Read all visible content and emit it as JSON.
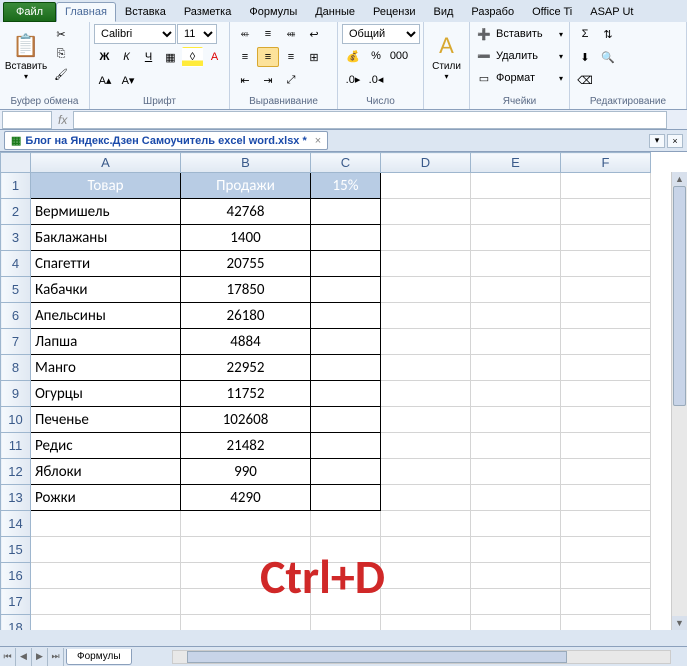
{
  "titlebar": {
    "help": "?",
    "minimize": "▭",
    "restore": "❐",
    "close": "✕"
  },
  "tabs": {
    "file": "Файл",
    "items": [
      "Главная",
      "Вставка",
      "Разметка",
      "Формулы",
      "Данные",
      "Рецензи",
      "Вид",
      "Разрабо",
      "Office Ti",
      "ASAP Ut"
    ]
  },
  "ribbon": {
    "clipboard": {
      "paste": "Вставить",
      "label": "Буфер обмена"
    },
    "font": {
      "name": "Calibri",
      "size": "11",
      "label": "Шрифт",
      "bold": "Ж",
      "italic": "К",
      "underline": "Ч"
    },
    "align": {
      "label": "Выравнивание"
    },
    "number": {
      "format": "Общий",
      "label": "Число"
    },
    "styles": {
      "btn": "Стили",
      "label": ""
    },
    "cells": {
      "insert": "Вставить",
      "delete": "Удалить",
      "format": "Формат",
      "label": "Ячейки"
    },
    "editing": {
      "label": "Редактирование"
    }
  },
  "formula": {
    "fx": "fx"
  },
  "doc": {
    "name": "Блог на Яндекс.Дзен Самоучитель excel word.xlsx *"
  },
  "grid": {
    "cols": [
      "A",
      "B",
      "C",
      "D",
      "E",
      "F"
    ],
    "rows": [
      "1",
      "2",
      "3",
      "4",
      "5",
      "6",
      "7",
      "8",
      "9",
      "10",
      "11",
      "12",
      "13",
      "14",
      "15",
      "16",
      "17",
      "18"
    ],
    "header": {
      "a": "Товар",
      "b": "Продажи",
      "c": "15%"
    },
    "data": [
      {
        "a": "Вермишель",
        "b": "42768"
      },
      {
        "a": "Баклажаны",
        "b": "1400"
      },
      {
        "a": "Спагетти",
        "b": "20755"
      },
      {
        "a": "Кабачки",
        "b": "17850"
      },
      {
        "a": "Апельсины",
        "b": "26180"
      },
      {
        "a": "Лапша",
        "b": "4884"
      },
      {
        "a": "Манго",
        "b": "22952"
      },
      {
        "a": "Огурцы",
        "b": "11752"
      },
      {
        "a": "Печенье",
        "b": "102608"
      },
      {
        "a": "Редис",
        "b": "21482"
      },
      {
        "a": "Яблоки",
        "b": "990"
      },
      {
        "a": "Рожки",
        "b": "4290"
      }
    ]
  },
  "overlay": "Ctrl+D",
  "sheet_tabs": {
    "first": "Формулы"
  },
  "chart_data": null
}
